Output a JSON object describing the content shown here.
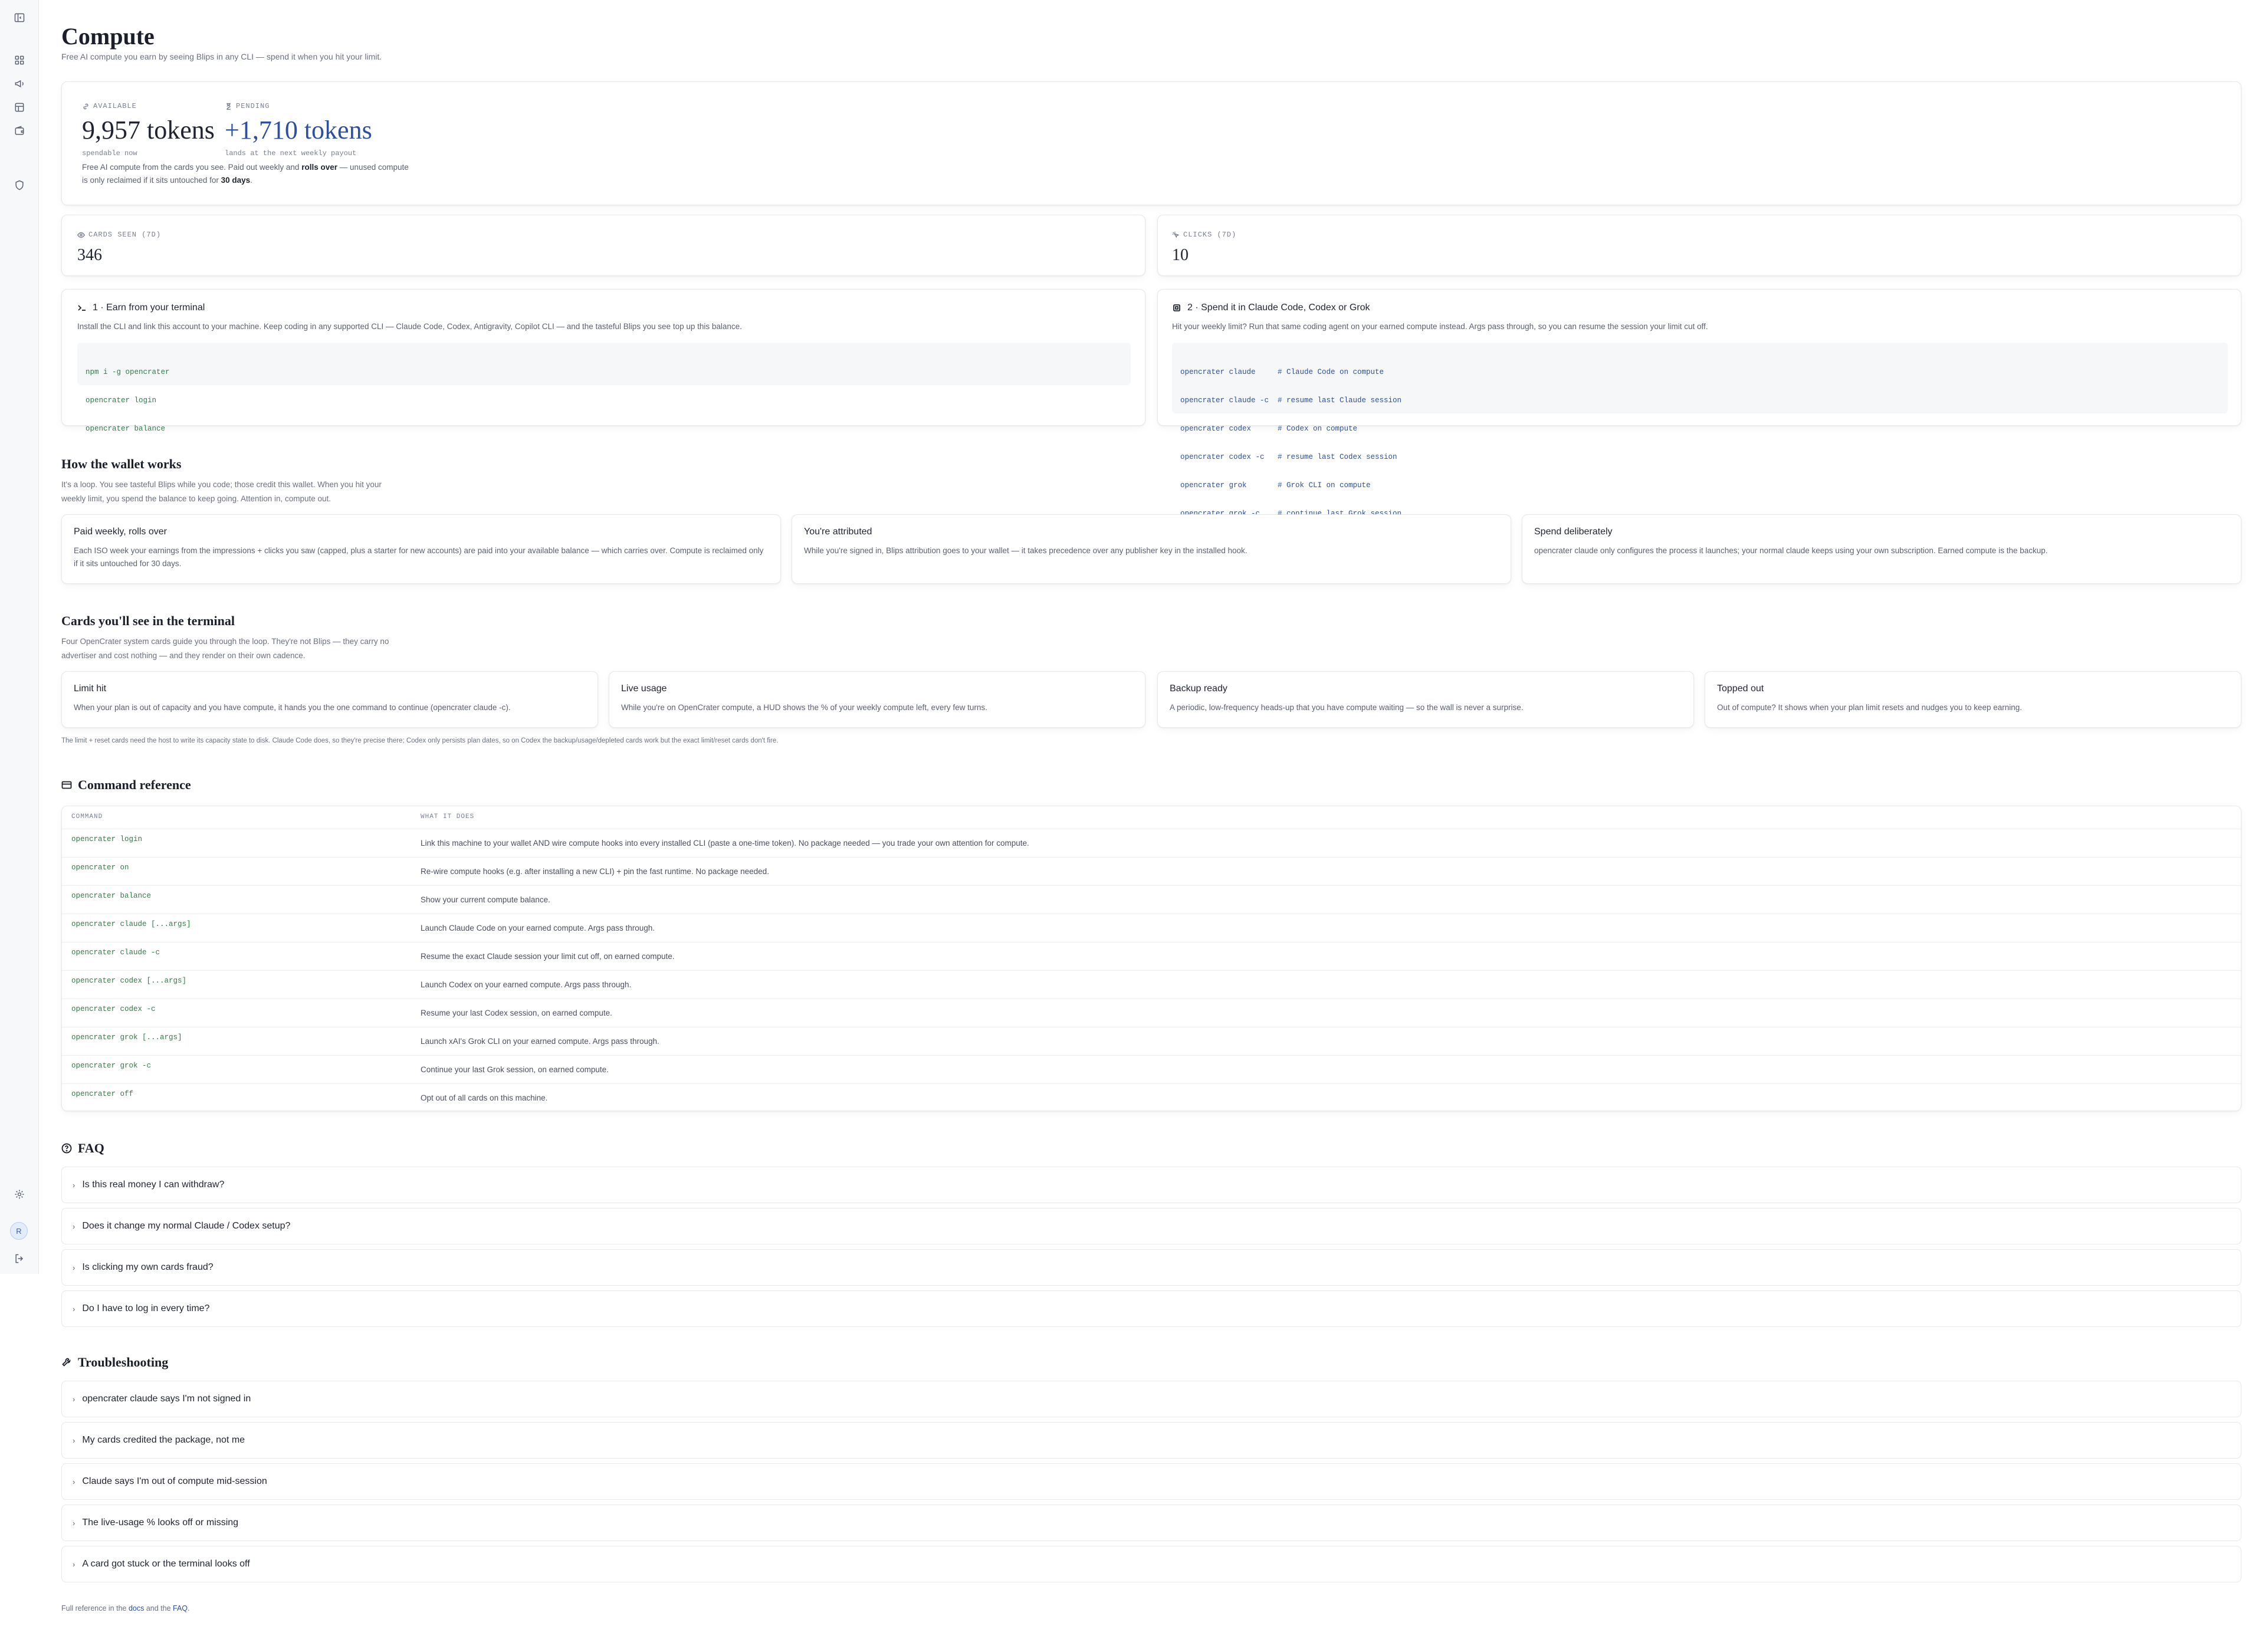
{
  "page": {
    "title": "Compute",
    "subtitle": "Free AI compute you earn by seeing Blips in any CLI — spend it when you hit your limit."
  },
  "sidebar": {
    "avatar_initial": "R"
  },
  "balance": {
    "available_label": "AVAILABLE",
    "available_value": "9,957 tokens",
    "available_note": "spendable now",
    "pending_label": "PENDING",
    "pending_value": "+1,710 tokens",
    "pending_note": "lands at the next weekly payout",
    "desc_part1": "Free AI compute from the cards you see. Paid out weekly and ",
    "desc_bold1": "rolls over",
    "desc_part2": " — unused compute is only reclaimed if it sits untouched for ",
    "desc_bold2": "30 days",
    "desc_part3": ".",
    "pending_color": "#2d4fa0"
  },
  "stats": [
    {
      "label": "CARDS SEEN (7D)",
      "value": "346"
    },
    {
      "label": "CLICKS (7D)",
      "value": "10"
    }
  ],
  "steps": [
    {
      "title": "1 · Earn from your terminal",
      "desc": "Install the CLI and link this account to your machine. Keep coding in any supported CLI — Claude Code, Codex, Antigravity, Copilot CLI — and the tasteful Blips you see top up this balance.",
      "code": [
        "npm i -g opencrater",
        "opencrater login",
        "opencrater balance"
      ]
    },
    {
      "title": "2 · Spend it in Claude Code, Codex or Grok",
      "desc": "Hit your weekly limit? Run that same coding agent on your earned compute instead. Args pass through, so you can resume the session your limit cut off.",
      "code": [
        "opencrater claude     # Claude Code on compute",
        "opencrater claude -c  # resume last Claude session",
        "opencrater codex      # Codex on compute",
        "opencrater codex -c   # resume last Codex session",
        "opencrater grok       # Grok CLI on compute",
        "opencrater grok -c    # continue last Grok session"
      ]
    }
  ],
  "wallet": {
    "title": "How the wallet works",
    "desc": "It's a loop. You see tasteful Blips while you code; those credit this wallet. When you hit your weekly limit, you spend the balance to keep going. Attention in, compute out.",
    "cards": [
      {
        "title": "Paid weekly, rolls over",
        "desc": "Each ISO week your earnings from the impressions + clicks you saw (capped, plus a starter for new accounts) are paid into your available balance — which carries over. Compute is reclaimed only if it sits untouched for 30 days."
      },
      {
        "title": "You're attributed",
        "desc": "While you're signed in, Blips attribution goes to your wallet — it takes precedence over any publisher key in the installed hook."
      },
      {
        "title": "Spend deliberately",
        "desc": "opencrater claude only configures the process it launches; your normal claude keeps using your own subscription. Earned compute is the backup."
      }
    ]
  },
  "terminal_cards": {
    "title": "Cards you'll see in the terminal",
    "desc": "Four OpenCrater system cards guide you through the loop. They're not Blips — they carry no advertiser and cost nothing — and they render on their own cadence.",
    "cards": [
      {
        "title": "Limit hit",
        "desc": "When your plan is out of capacity and you have compute, it hands you the one command to continue (opencrater claude -c)."
      },
      {
        "title": "Live usage",
        "desc": "While you're on OpenCrater compute, a HUD shows the % of your weekly compute left, every few turns."
      },
      {
        "title": "Backup ready",
        "desc": "A periodic, low-frequency heads-up that you have compute waiting — so the wall is never a surprise."
      },
      {
        "title": "Topped out",
        "desc": "Out of compute? It shows when your plan limit resets and nudges you to keep earning."
      }
    ],
    "footnote": "The limit + reset cards need the host to write its capacity state to disk. Claude Code does, so they're precise there; Codex only persists plan dates, so on Codex the backup/usage/depleted cards work but the exact limit/reset cards don't fire."
  },
  "commands": {
    "title": "Command reference",
    "col_command": "COMMAND",
    "col_desc": "WHAT IT DOES",
    "rows": [
      {
        "cmd": "opencrater login",
        "desc": "Link this machine to your wallet AND wire compute hooks into every installed CLI (paste a one-time token). No package needed — you trade your own attention for compute."
      },
      {
        "cmd": "opencrater on",
        "desc": "Re-wire compute hooks (e.g. after installing a new CLI) + pin the fast runtime. No package needed."
      },
      {
        "cmd": "opencrater balance",
        "desc": "Show your current compute balance."
      },
      {
        "cmd": "opencrater claude [...args]",
        "desc": "Launch Claude Code on your earned compute. Args pass through."
      },
      {
        "cmd": "opencrater claude -c",
        "desc": "Resume the exact Claude session your limit cut off, on earned compute."
      },
      {
        "cmd": "opencrater codex [...args]",
        "desc": "Launch Codex on your earned compute. Args pass through."
      },
      {
        "cmd": "opencrater codex -c",
        "desc": "Resume your last Codex session, on earned compute."
      },
      {
        "cmd": "opencrater grok [...args]",
        "desc": "Launch xAI's Grok CLI on your earned compute. Args pass through."
      },
      {
        "cmd": "opencrater grok -c",
        "desc": "Continue your last Grok session, on earned compute."
      },
      {
        "cmd": "opencrater off",
        "desc": "Opt out of all cards on this machine."
      }
    ]
  },
  "faq": {
    "title": "FAQ",
    "items": [
      "Is this real money I can withdraw?",
      "Does it change my normal Claude / Codex setup?",
      "Is clicking my own cards fraud?",
      "Do I have to log in every time?"
    ]
  },
  "troubleshooting": {
    "title": "Troubleshooting",
    "items": [
      "opencrater claude says I'm not signed in",
      "My cards credited the package, not me",
      "Claude says I'm out of compute mid-session",
      "The live-usage % looks off or missing",
      "A card got stuck or the terminal looks off"
    ]
  },
  "footer": {
    "prefix": "Full reference in the ",
    "docs_link": "docs",
    "middle": " and the ",
    "faq_link": "FAQ",
    "suffix": "."
  }
}
